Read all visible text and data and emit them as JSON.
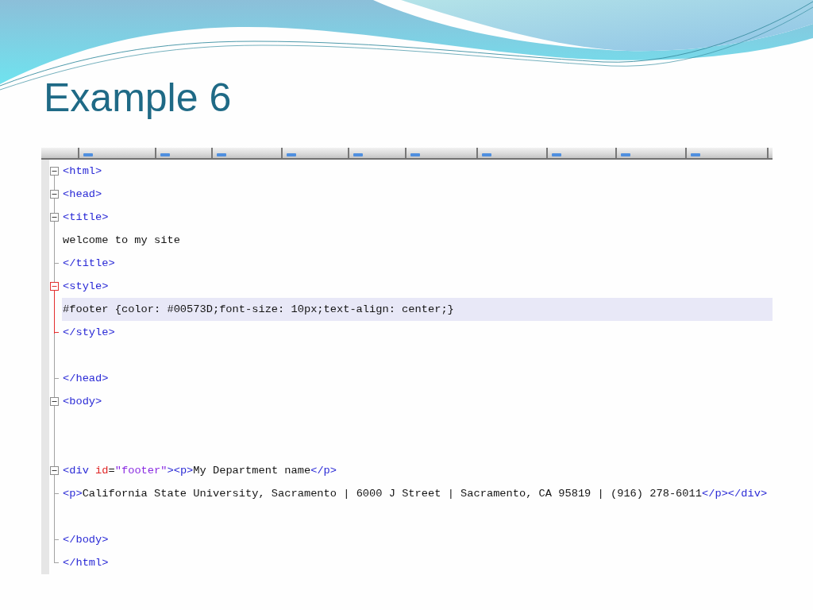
{
  "slide": {
    "title": "Example 6"
  },
  "editor": {
    "lines": [
      {
        "kind": "open",
        "active_fold": false,
        "highlighted": false,
        "segments": [
          {
            "kind": "tag",
            "text": "<html>"
          }
        ]
      },
      {
        "kind": "open",
        "active_fold": false,
        "highlighted": false,
        "segments": [
          {
            "kind": "tag",
            "text": "<head>"
          }
        ]
      },
      {
        "kind": "open",
        "active_fold": false,
        "highlighted": false,
        "segments": [
          {
            "kind": "tag",
            "text": "<title>"
          }
        ]
      },
      {
        "kind": "line",
        "active_fold": false,
        "highlighted": false,
        "segments": [
          {
            "kind": "text",
            "text": "welcome to my site"
          }
        ]
      },
      {
        "kind": "end",
        "active_fold": false,
        "highlighted": false,
        "segments": [
          {
            "kind": "tag",
            "text": "</title>"
          }
        ]
      },
      {
        "kind": "open",
        "active_fold": true,
        "highlighted": false,
        "segments": [
          {
            "kind": "tag",
            "text": "<style>"
          }
        ]
      },
      {
        "kind": "line",
        "active_fold": true,
        "highlighted": true,
        "segments": [
          {
            "kind": "text",
            "text": "#footer {color: #00573D;font-size: 10px;text-align: center;}"
          }
        ]
      },
      {
        "kind": "end",
        "active_fold": true,
        "highlighted": false,
        "segments": [
          {
            "kind": "tag",
            "text": "</style>"
          }
        ]
      },
      {
        "kind": "line",
        "active_fold": false,
        "highlighted": false
      },
      {
        "kind": "end",
        "active_fold": false,
        "highlighted": false,
        "segments": [
          {
            "kind": "tag",
            "text": "</head>"
          }
        ]
      },
      {
        "kind": "open",
        "active_fold": false,
        "highlighted": false,
        "segments": [
          {
            "kind": "tag",
            "text": "<body>"
          }
        ]
      },
      {
        "kind": "line",
        "active_fold": false,
        "highlighted": false
      },
      {
        "kind": "line",
        "active_fold": false,
        "highlighted": false
      },
      {
        "kind": "open",
        "active_fold": false,
        "highlighted": false,
        "segments": [
          {
            "kind": "tag",
            "text": "<div "
          },
          {
            "kind": "attr",
            "text": "id"
          },
          {
            "kind": "text",
            "text": "="
          },
          {
            "kind": "value",
            "text": "\"footer\""
          },
          {
            "kind": "tag",
            "text": "><p>"
          },
          {
            "kind": "text",
            "text": "My Department name"
          },
          {
            "kind": "tag",
            "text": "</p>"
          }
        ]
      },
      {
        "kind": "end",
        "active_fold": false,
        "highlighted": false,
        "segments": [
          {
            "kind": "tag",
            "text": "<p>"
          },
          {
            "kind": "text",
            "text": "California State University, Sacramento | 6000 J Street | Sacramento, CA 95819 | (916) 278-6011"
          },
          {
            "kind": "tag",
            "text": "</p></div>"
          }
        ]
      },
      {
        "kind": "line",
        "active_fold": false,
        "highlighted": false
      },
      {
        "kind": "end",
        "active_fold": false,
        "highlighted": false,
        "segments": [
          {
            "kind": "tag",
            "text": "</body>"
          }
        ]
      },
      {
        "kind": "last",
        "active_fold": false,
        "highlighted": false,
        "segments": [
          {
            "kind": "tag",
            "text": "</html>"
          }
        ]
      }
    ]
  }
}
